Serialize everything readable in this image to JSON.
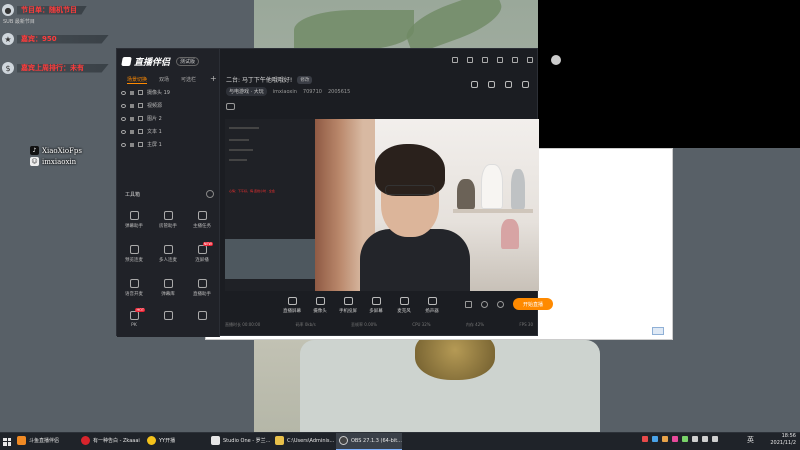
{
  "overlay": {
    "stats": [
      {
        "icon": "user-icon",
        "text": "节目单：随机节目",
        "sub": "SUB 最新节目"
      },
      {
        "icon": "star-icon",
        "text": "嘉宾：950",
        "sub": ""
      },
      {
        "icon": "dollar-icon",
        "text": "嘉宾上周排行：未有",
        "sub": ""
      }
    ],
    "social": [
      {
        "icon": "tiktok-icon",
        "name": "XiaoXioFps"
      },
      {
        "icon": "people-icon",
        "name": "imxiaoxin"
      }
    ]
  },
  "app": {
    "name": "直播伴侣",
    "version": "测试版",
    "tabs": [
      "场景切换",
      "双场",
      "可选栏"
    ],
    "active_tab": 0,
    "scenes": [
      {
        "label": "摄像头 19"
      },
      {
        "label": "视频源"
      },
      {
        "label": "图片 2"
      },
      {
        "label": "文本 1"
      },
      {
        "label": "主屏 1"
      }
    ],
    "tools_title": "工具箱",
    "tools": [
      {
        "label": "弹幕助手",
        "hot": ""
      },
      {
        "label": "房管助手",
        "hot": ""
      },
      {
        "label": "主播任务",
        "hot": ""
      },
      {
        "label": "预览连麦",
        "hot": ""
      },
      {
        "label": "多人连麦",
        "hot": ""
      },
      {
        "label": "连屏播",
        "hot": "NEW"
      },
      {
        "label": "语音开麦",
        "hot": ""
      },
      {
        "label": "弹幕库",
        "hot": ""
      },
      {
        "label": "直播助手",
        "hot": ""
      },
      {
        "label": "PK",
        "hot": "HOT"
      },
      {
        "label": "",
        "hot": ""
      },
      {
        "label": "",
        "hot": ""
      }
    ],
    "room_title": "二台: 马丁下午他哦哦好!",
    "room_edit": "修改",
    "category": "与电游戏 · 大玩",
    "room_user": "imxiaoxin",
    "room_id": "709710",
    "viewers": "2005615",
    "controls": [
      "直播屏幕",
      "摄像头",
      "手机投屏",
      "多屏幕",
      "麦克风",
      "扬声器"
    ],
    "start_label": "开始直播",
    "nested_text": "心情：下午好，嗨·连线小时 · 全会",
    "status": [
      "直播时长 00:00:00",
      "码率 0kb/s",
      "丢帧率 0.00%",
      "CPU 32%",
      "内存 42%",
      "FPS 30"
    ]
  },
  "taskbar": {
    "items": [
      {
        "icon": "live-icon",
        "label": "斗鱼直播伴侣",
        "color": "#f08a24",
        "active": false
      },
      {
        "icon": "netease-icon",
        "label": "有一种告白 - Zkaaai",
        "color": "#d8242c",
        "active": false
      },
      {
        "icon": "yy-icon",
        "label": "YY开播",
        "color": "#f4c21b",
        "active": false
      },
      {
        "icon": "studio-icon",
        "label": "Studio One - 罗兰...",
        "color": "#e6e6e6",
        "active": false
      },
      {
        "icon": "folder-icon",
        "label": "C:\\Users\\Adminis...",
        "color": "#e8c04a",
        "active": false
      },
      {
        "icon": "obs-icon",
        "label": "OBS 27.1.3 (64-bit...",
        "color": "#444",
        "active": true
      }
    ],
    "lang": "英",
    "time": "18:56",
    "date": "2021/11/2"
  }
}
